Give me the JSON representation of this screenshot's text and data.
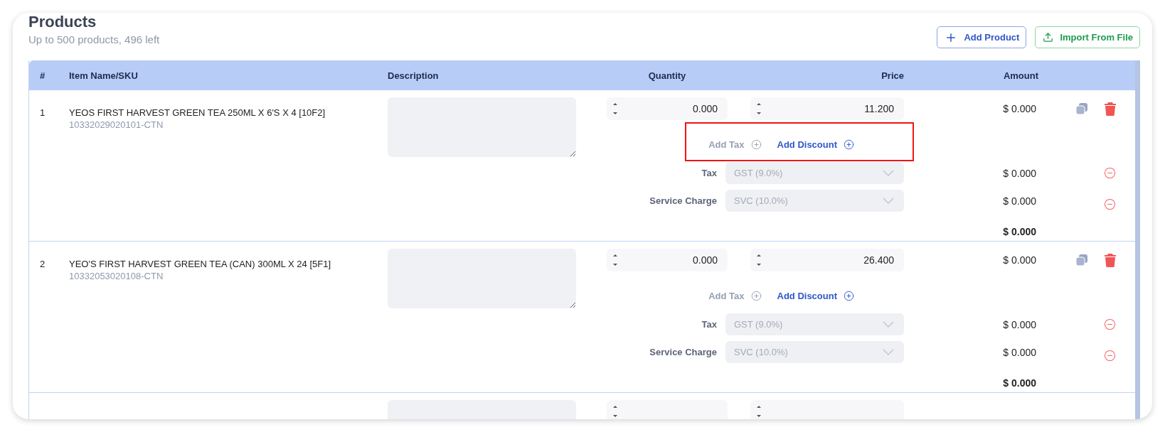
{
  "title": "Products",
  "subtitle": "Up to 500 products, 496 left",
  "actions": [
    {
      "kind": "add",
      "label": "Add Product"
    },
    {
      "kind": "import",
      "label": "Import From File"
    }
  ],
  "table": {
    "columns": [
      "#",
      "Item Name/SKU",
      "Description",
      "Quantity",
      "Price",
      "Amount"
    ],
    "rows": [
      {
        "index": "1",
        "name": "YEOS FIRST HARVEST GREEN TEA 250ML X 6'S X 4 [10F2]",
        "sku": "10332029020101-CTN",
        "quantity": "0.000",
        "price": "11.200",
        "amount": "$ 0.000",
        "add_tax": {
          "label": "Add Tax",
          "disabled": true
        },
        "add_discount": {
          "label": "Add Discount",
          "disabled": false
        },
        "highlighted": true,
        "charges": [
          {
            "label": "Tax",
            "value": "GST (9.0%)",
            "amount": "$ 0.000"
          },
          {
            "label": "Service Charge",
            "value": "SVC (10.0%)",
            "amount": "$ 0.000"
          }
        ],
        "total": "$ 0.000"
      },
      {
        "index": "2",
        "name": "YEO'S FIRST HARVEST GREEN TEA (CAN) 300ML X 24 [5F1]",
        "sku": "10332053020108-CTN",
        "quantity": "0.000",
        "price": "26.400",
        "amount": "$ 0.000",
        "add_tax": {
          "label": "Add Tax",
          "disabled": true
        },
        "add_discount": {
          "label": "Add Discount",
          "disabled": false
        },
        "highlighted": false,
        "charges": [
          {
            "label": "Tax",
            "value": "GST (9.0%)",
            "amount": "$ 0.000"
          },
          {
            "label": "Service Charge",
            "value": "SVC (10.0%)",
            "amount": "$ 0.000"
          }
        ],
        "total": "$ 0.000"
      }
    ],
    "more_rows_below": true
  }
}
